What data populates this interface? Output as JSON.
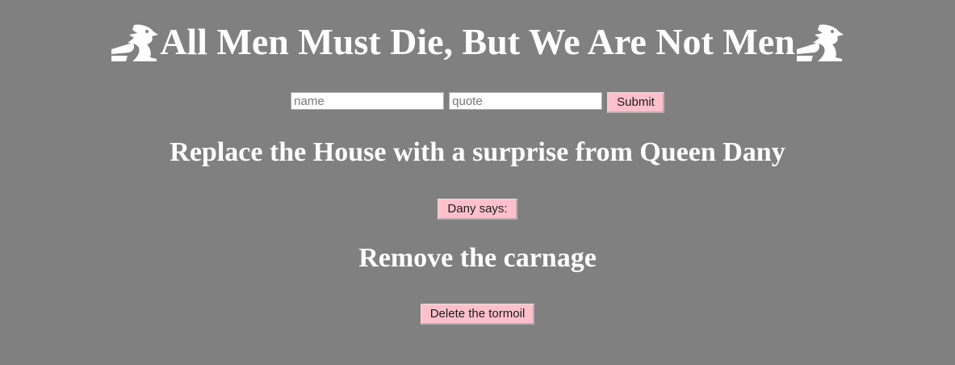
{
  "header": {
    "title": "All Men Must Die, But We Are Not Men",
    "left_icon": "dragon-icon",
    "right_icon": "dragon-icon"
  },
  "form": {
    "name_placeholder": "name",
    "quote_placeholder": "quote",
    "name_value": "",
    "quote_value": "",
    "submit_label": "Submit"
  },
  "replace_section": {
    "heading": "Replace the House with a surprise from Queen Dany",
    "button_label": "Dany says:"
  },
  "remove_section": {
    "heading": "Remove the carnage",
    "button_label": "Delete the tormoil"
  },
  "colors": {
    "background": "#808080",
    "text": "#ffffff",
    "button": "#ffc0cb"
  }
}
